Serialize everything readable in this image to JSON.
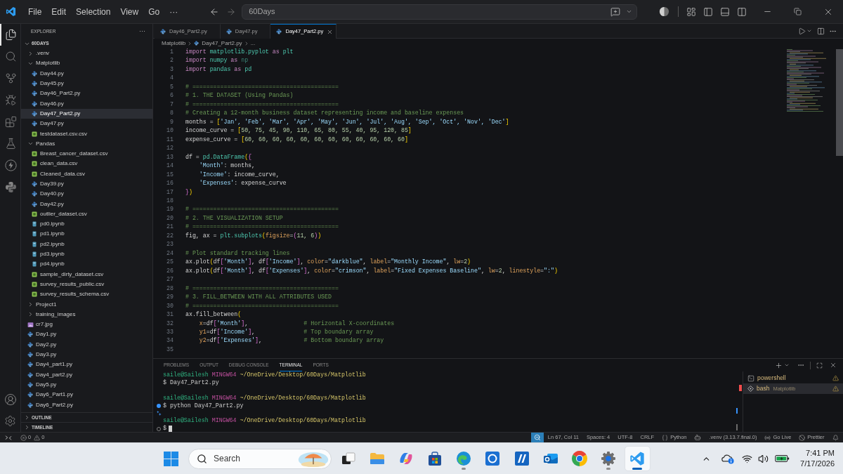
{
  "title_bar": {
    "menu": [
      "File",
      "Edit",
      "Selection",
      "View",
      "Go",
      "···"
    ],
    "command_center": "60Days"
  },
  "activity_bar": {
    "top": [
      {
        "kind": "explorer",
        "selected": true
      },
      {
        "kind": "search",
        "selected": false
      },
      {
        "kind": "source_control",
        "selected": false
      },
      {
        "kind": "run_debug",
        "selected": false
      },
      {
        "kind": "extensions",
        "selected": false
      },
      {
        "kind": "testing",
        "selected": false
      },
      {
        "kind": "lightning",
        "selected": false
      },
      {
        "kind": "python",
        "selected": false
      }
    ],
    "bottom": [
      {
        "kind": "account"
      },
      {
        "kind": "settings"
      }
    ]
  },
  "explorer": {
    "title": "EXPLORER",
    "more": "···",
    "root": {
      "label": "60DAYS",
      "expanded": true,
      "children": [
        {
          "label": ".venv",
          "kind": "folder",
          "expanded": false,
          "selected": false
        },
        {
          "label": "Matplotlib",
          "kind": "folder",
          "expanded": true,
          "selected": false,
          "children": [
            {
              "label": "Day44.py",
              "kind": "python",
              "selected": false
            },
            {
              "label": "Day45.py",
              "kind": "python",
              "selected": false
            },
            {
              "label": "Day46_Part2.py",
              "kind": "python",
              "selected": false
            },
            {
              "label": "Day46.py",
              "kind": "python",
              "selected": false
            },
            {
              "label": "Day47_Part2.py",
              "kind": "python",
              "selected": true
            },
            {
              "label": "Day47.py",
              "kind": "python",
              "selected": false
            },
            {
              "label": "testdataset.csv.csv",
              "kind": "csv",
              "selected": false
            }
          ]
        },
        {
          "label": "Pandas",
          "kind": "folder",
          "expanded": true,
          "selected": false,
          "children": [
            {
              "label": "Breast_cancer_dataset.csv",
              "kind": "csv",
              "selected": false
            },
            {
              "label": "clean_data.csv",
              "kind": "csv",
              "selected": false
            },
            {
              "label": "Cleaned_data.csv",
              "kind": "csv",
              "selected": false
            },
            {
              "label": "Day39.py",
              "kind": "python",
              "selected": false
            },
            {
              "label": "Day40.py",
              "kind": "python",
              "selected": false
            },
            {
              "label": "Day42.py",
              "kind": "python",
              "selected": false
            },
            {
              "label": "outlier_dataset.csv",
              "kind": "csv",
              "selected": false
            },
            {
              "label": "pd0.ipynb",
              "kind": "notebook",
              "selected": false
            },
            {
              "label": "pd1.ipynb",
              "kind": "notebook",
              "selected": false
            },
            {
              "label": "pd2.ipynb",
              "kind": "notebook",
              "selected": false
            },
            {
              "label": "pd3.ipynb",
              "kind": "notebook",
              "selected": false
            },
            {
              "label": "pd4.ipynb",
              "kind": "notebook",
              "selected": false
            },
            {
              "label": "sample_dirty_dataset.csv",
              "kind": "csv",
              "selected": false
            },
            {
              "label": "survey_results_public.csv",
              "kind": "csv",
              "selected": false
            },
            {
              "label": "survey_results_schema.csv",
              "kind": "csv",
              "selected": false
            }
          ]
        },
        {
          "label": "Project1",
          "kind": "folder",
          "expanded": false,
          "selected": false
        },
        {
          "label": "training_images",
          "kind": "folder",
          "expanded": false,
          "selected": false
        },
        {
          "label": "cr7.jpg",
          "kind": "image",
          "selected": false
        },
        {
          "label": "Day1.py",
          "kind": "python",
          "selected": false
        },
        {
          "label": "Day2.py",
          "kind": "python",
          "selected": false
        },
        {
          "label": "Day3.py",
          "kind": "python",
          "selected": false
        },
        {
          "label": "Day4_part1.py",
          "kind": "python",
          "selected": false
        },
        {
          "label": "Day4_part2.py",
          "kind": "python",
          "selected": false
        },
        {
          "label": "Day5.py",
          "kind": "python",
          "selected": false
        },
        {
          "label": "Day6_Part1.py",
          "kind": "python",
          "selected": false
        },
        {
          "label": "Day6_Part2.py",
          "kind": "python",
          "selected": false
        }
      ]
    },
    "sections": [
      {
        "label": "OUTLINE",
        "expanded": false
      },
      {
        "label": "TIMELINE",
        "expanded": false
      }
    ]
  },
  "editor": {
    "tabs": [
      {
        "label": "Day46_Part2.py",
        "selected": false
      },
      {
        "label": "Day47.py",
        "selected": false
      },
      {
        "label": "Day47_Part2.py",
        "selected": true
      }
    ],
    "breadcrumb": [
      {
        "label": "Matplotlib",
        "kind": "folder"
      },
      {
        "label": "Day47_Part2.py",
        "kind": "python"
      },
      {
        "label": "...",
        "kind": "symbol"
      }
    ],
    "lines": [
      {
        "number": "1",
        "tokens": [
          {
            "kind": "keyword",
            "text": "import "
          },
          {
            "kind": "module",
            "text": "matplotlib.pyplot"
          },
          {
            "kind": "keyword",
            "text": " as "
          },
          {
            "kind": "module",
            "text": "plt"
          }
        ]
      },
      {
        "number": "2",
        "tokens": [
          {
            "kind": "keyword",
            "text": "import "
          },
          {
            "kind": "module",
            "text": "numpy"
          },
          {
            "kind": "keyword",
            "text": " as "
          },
          {
            "kind": "unused",
            "text": "np"
          }
        ]
      },
      {
        "number": "3",
        "tokens": [
          {
            "kind": "keyword",
            "text": "import "
          },
          {
            "kind": "module",
            "text": "pandas"
          },
          {
            "kind": "keyword",
            "text": " as "
          },
          {
            "kind": "module",
            "text": "pd"
          }
        ]
      },
      {
        "number": "4"
      },
      {
        "number": "5",
        "tokens": [
          {
            "kind": "comment",
            "text": "# =========================================="
          }
        ]
      },
      {
        "number": "6",
        "tokens": [
          {
            "kind": "comment",
            "text": "# 1. THE DATASET (Using Pandas)"
          }
        ]
      },
      {
        "number": "7",
        "tokens": [
          {
            "kind": "comment",
            "text": "# =========================================="
          }
        ]
      },
      {
        "number": "8",
        "tokens": [
          {
            "kind": "comment",
            "text": "# Creating a 12-month business dataset representing income and baseline expenses"
          }
        ]
      },
      {
        "number": "9",
        "tokens": [
          {
            "kind": "plain",
            "text": "months = "
          },
          {
            "kind": "bracket",
            "text": "["
          },
          {
            "kind": "string",
            "text": "'Jan', 'Feb', 'Mar', 'Apr', 'May', 'Jun', 'Jul', 'Aug', 'Sep', 'Oct', 'Nov', 'Dec'"
          },
          {
            "kind": "bracket",
            "text": "]"
          }
        ]
      },
      {
        "number": "10",
        "tokens": [
          {
            "kind": "plain",
            "text": "income_curve = "
          },
          {
            "kind": "bracket",
            "text": "["
          },
          {
            "kind": "number",
            "text": "50, 75, 45, 90, 110, 65, 80, 55, 40, 95, 120, 85"
          },
          {
            "kind": "bracket",
            "text": "]"
          }
        ]
      },
      {
        "number": "11",
        "tokens": [
          {
            "kind": "plain",
            "text": "expense_curve = "
          },
          {
            "kind": "bracket",
            "text": "["
          },
          {
            "kind": "number",
            "text": "60, 60, 60, 60, 60, 60, 60, 60, 60, 60, 60, 60"
          },
          {
            "kind": "bracket",
            "text": "]"
          }
        ]
      },
      {
        "number": "12"
      },
      {
        "number": "13",
        "tokens": [
          {
            "kind": "plain",
            "text": "df = "
          },
          {
            "kind": "module",
            "text": "pd.DataFrame"
          },
          {
            "kind": "bracket",
            "text": "("
          },
          {
            "kind": "nested_bracket",
            "text": "{"
          }
        ]
      },
      {
        "number": "14",
        "tokens": [
          {
            "kind": "string",
            "text": "    'Month'"
          },
          {
            "kind": "plain",
            "text": ": months,"
          }
        ]
      },
      {
        "number": "15",
        "tokens": [
          {
            "kind": "string",
            "text": "    'Income'"
          },
          {
            "kind": "plain",
            "text": ": income_curve,"
          }
        ]
      },
      {
        "number": "16",
        "tokens": [
          {
            "kind": "string",
            "text": "    'Expenses'"
          },
          {
            "kind": "plain",
            "text": ": expense_curve"
          }
        ]
      },
      {
        "number": "17",
        "tokens": [
          {
            "kind": "nested_bracket",
            "text": "}"
          },
          {
            "kind": "bracket",
            "text": ")"
          }
        ]
      },
      {
        "number": "18"
      },
      {
        "number": "19",
        "tokens": [
          {
            "kind": "comment",
            "text": "# =========================================="
          }
        ]
      },
      {
        "number": "20",
        "tokens": [
          {
            "kind": "comment",
            "text": "# 2. THE VISUALIZATION SETUP"
          }
        ]
      },
      {
        "number": "21",
        "tokens": [
          {
            "kind": "comment",
            "text": "# =========================================="
          }
        ]
      },
      {
        "number": "22",
        "tokens": [
          {
            "kind": "plain",
            "text": "fig, ax = "
          },
          {
            "kind": "module",
            "text": "plt.subplots"
          },
          {
            "kind": "bracket",
            "text": "("
          },
          {
            "kind": "parameter",
            "text": "figsize"
          },
          {
            "kind": "plain",
            "text": "="
          },
          {
            "kind": "nested_bracket",
            "text": "("
          },
          {
            "kind": "number",
            "text": "11, 6"
          },
          {
            "kind": "nested_bracket",
            "text": ")"
          },
          {
            "kind": "bracket",
            "text": ")"
          }
        ]
      },
      {
        "number": "23"
      },
      {
        "number": "24",
        "tokens": [
          {
            "kind": "comment",
            "text": "# Plot standard tracking lines"
          }
        ]
      },
      {
        "number": "25",
        "tokens": [
          {
            "kind": "plain",
            "text": "ax.plot"
          },
          {
            "kind": "bracket",
            "text": "("
          },
          {
            "kind": "plain",
            "text": "df"
          },
          {
            "kind": "nested_bracket",
            "text": "["
          },
          {
            "kind": "string",
            "text": "'Month'"
          },
          {
            "kind": "nested_bracket",
            "text": "]"
          },
          {
            "kind": "plain",
            "text": ", df"
          },
          {
            "kind": "nested_bracket",
            "text": "["
          },
          {
            "kind": "string",
            "text": "'Income'"
          },
          {
            "kind": "nested_bracket",
            "text": "]"
          },
          {
            "kind": "plain",
            "text": ", "
          },
          {
            "kind": "parameter",
            "text": "color"
          },
          {
            "kind": "plain",
            "text": "="
          },
          {
            "kind": "string",
            "text": "\"darkblue\""
          },
          {
            "kind": "plain",
            "text": ", "
          },
          {
            "kind": "parameter",
            "text": "label"
          },
          {
            "kind": "plain",
            "text": "="
          },
          {
            "kind": "string",
            "text": "\"Monthly Income\""
          },
          {
            "kind": "plain",
            "text": ", "
          },
          {
            "kind": "parameter",
            "text": "lw"
          },
          {
            "kind": "plain",
            "text": "="
          },
          {
            "kind": "number",
            "text": "2"
          },
          {
            "kind": "bracket",
            "text": ")"
          }
        ]
      },
      {
        "number": "26",
        "tokens": [
          {
            "kind": "plain",
            "text": "ax.plot"
          },
          {
            "kind": "bracket",
            "text": "("
          },
          {
            "kind": "plain",
            "text": "df"
          },
          {
            "kind": "nested_bracket",
            "text": "["
          },
          {
            "kind": "string",
            "text": "'Month'"
          },
          {
            "kind": "nested_bracket",
            "text": "]"
          },
          {
            "kind": "plain",
            "text": ", df"
          },
          {
            "kind": "nested_bracket",
            "text": "["
          },
          {
            "kind": "string",
            "text": "'Expenses'"
          },
          {
            "kind": "nested_bracket",
            "text": "]"
          },
          {
            "kind": "plain",
            "text": ", "
          },
          {
            "kind": "parameter",
            "text": "color"
          },
          {
            "kind": "plain",
            "text": "="
          },
          {
            "kind": "string",
            "text": "\"crimson\""
          },
          {
            "kind": "plain",
            "text": ", "
          },
          {
            "kind": "parameter",
            "text": "label"
          },
          {
            "kind": "plain",
            "text": "="
          },
          {
            "kind": "string",
            "text": "\"Fixed Expenses Baseline\""
          },
          {
            "kind": "plain",
            "text": ", "
          },
          {
            "kind": "parameter",
            "text": "lw"
          },
          {
            "kind": "plain",
            "text": "="
          },
          {
            "kind": "number",
            "text": "2"
          },
          {
            "kind": "plain",
            "text": ", "
          },
          {
            "kind": "parameter",
            "text": "linestyle"
          },
          {
            "kind": "plain",
            "text": "="
          },
          {
            "kind": "string",
            "text": "\":\""
          },
          {
            "kind": "bracket",
            "text": ")"
          }
        ]
      },
      {
        "number": "27"
      },
      {
        "number": "28",
        "tokens": [
          {
            "kind": "comment",
            "text": "# =========================================="
          }
        ]
      },
      {
        "number": "29",
        "tokens": [
          {
            "kind": "comment",
            "text": "# 3. FILL_BETWEEN WITH ALL ATTRIBUTES USED"
          }
        ]
      },
      {
        "number": "30",
        "tokens": [
          {
            "kind": "comment",
            "text": "# =========================================="
          }
        ]
      },
      {
        "number": "31",
        "tokens": [
          {
            "kind": "plain",
            "text": "ax.fill_between"
          },
          {
            "kind": "bracket",
            "text": "("
          }
        ]
      },
      {
        "number": "32",
        "tokens": [
          {
            "kind": "parameter",
            "text": "    x"
          },
          {
            "kind": "plain",
            "text": "=df"
          },
          {
            "kind": "nested_bracket",
            "text": "["
          },
          {
            "kind": "string",
            "text": "'Month'"
          },
          {
            "kind": "nested_bracket",
            "text": "]"
          },
          {
            "kind": "plain",
            "text": ",                "
          },
          {
            "kind": "comment",
            "text": "# Horizontal X-coordinates"
          }
        ]
      },
      {
        "number": "33",
        "tokens": [
          {
            "kind": "parameter",
            "text": "    y1"
          },
          {
            "kind": "plain",
            "text": "=df"
          },
          {
            "kind": "nested_bracket",
            "text": "["
          },
          {
            "kind": "string",
            "text": "'Income'"
          },
          {
            "kind": "nested_bracket",
            "text": "]"
          },
          {
            "kind": "plain",
            "text": ",              "
          },
          {
            "kind": "comment",
            "text": "# Top boundary array"
          }
        ]
      },
      {
        "number": "34",
        "tokens": [
          {
            "kind": "parameter",
            "text": "    y2"
          },
          {
            "kind": "plain",
            "text": "=df"
          },
          {
            "kind": "nested_bracket",
            "text": "["
          },
          {
            "kind": "string",
            "text": "'Expenses'"
          },
          {
            "kind": "nested_bracket",
            "text": "]"
          },
          {
            "kind": "plain",
            "text": ",            "
          },
          {
            "kind": "comment",
            "text": "# Bottom boundary array"
          }
        ]
      },
      {
        "number": "35"
      }
    ]
  },
  "panel": {
    "tabs": [
      {
        "label": "PROBLEMS",
        "selected": false
      },
      {
        "label": "OUTPUT",
        "selected": false
      },
      {
        "label": "DEBUG CONSOLE",
        "selected": false
      },
      {
        "label": "TERMINAL",
        "selected": true
      },
      {
        "label": "PORTS",
        "selected": false
      }
    ],
    "terminal": [
      {
        "kind": "prompt",
        "user": "saile@Sailesh",
        "host": "MINGW64",
        "path": "~/OneDrive/Desktop/60Days/Matplotlib"
      },
      {
        "kind": "command",
        "text": "$ Day47_Part2.py",
        "decorated": false,
        "cursor": false
      },
      {
        "kind": "blank"
      },
      {
        "kind": "prompt",
        "user": "saile@Sailesh",
        "host": "MINGW64",
        "path": "~/OneDrive/Desktop/60Days/Matplotlib"
      },
      {
        "kind": "command",
        "text": "$ python Day47_Part2.py",
        "decorated": true,
        "finished": true,
        "cursor": false
      },
      {
        "kind": "hint"
      },
      {
        "kind": "prompt",
        "user": "saile@Sailesh",
        "host": "MINGW64",
        "path": "~/OneDrive/Desktop/60Days/Matplotlib"
      },
      {
        "kind": "command",
        "text": "$",
        "decorated": true,
        "finished": false,
        "cursor": true
      }
    ],
    "sessions": [
      {
        "name": "powershell",
        "kind": "powershell",
        "selected": false
      },
      {
        "name": "bash",
        "detail": "Matplotlib",
        "kind": "bash",
        "selected": true
      }
    ]
  },
  "status_bar": {
    "errors": "0",
    "warnings": "0",
    "items": [
      {
        "kind": "zoom"
      },
      {
        "kind": "text",
        "text": "Ln 67, Col 11"
      },
      {
        "kind": "text",
        "text": "Spaces: 4"
      },
      {
        "kind": "text",
        "text": "UTF-8"
      },
      {
        "kind": "text",
        "text": "CRLF"
      },
      {
        "kind": "language",
        "text": "Python"
      },
      {
        "kind": "copilot"
      },
      {
        "kind": "text",
        "text": ".venv (3.13.7.final.0)"
      },
      {
        "kind": "live",
        "text": "Go Live"
      },
      {
        "kind": "formatter",
        "text": "Prettier"
      },
      {
        "kind": "notifications"
      }
    ]
  },
  "taskbar": {
    "search": {
      "placeholder": "Search"
    },
    "apps": [
      {
        "kind": "task_view",
        "running": false,
        "selected": false
      },
      {
        "kind": "folder",
        "running": false,
        "selected": false
      },
      {
        "kind": "assistant",
        "running": false,
        "selected": false
      },
      {
        "kind": "store",
        "running": false,
        "selected": false
      },
      {
        "kind": "browser",
        "running": true,
        "selected": false
      },
      {
        "kind": "ring_app",
        "running": false,
        "selected": false
      },
      {
        "kind": "slash_app",
        "running": false,
        "selected": false
      },
      {
        "kind": "mail",
        "running": false,
        "selected": false
      },
      {
        "kind": "round_browser",
        "running": false,
        "selected": false
      },
      {
        "kind": "settings",
        "running": true,
        "selected": false
      },
      {
        "kind": "code_editor",
        "running": true,
        "selected": true
      }
    ],
    "time": "7:41 PM",
    "date": "7/17/2026"
  }
}
